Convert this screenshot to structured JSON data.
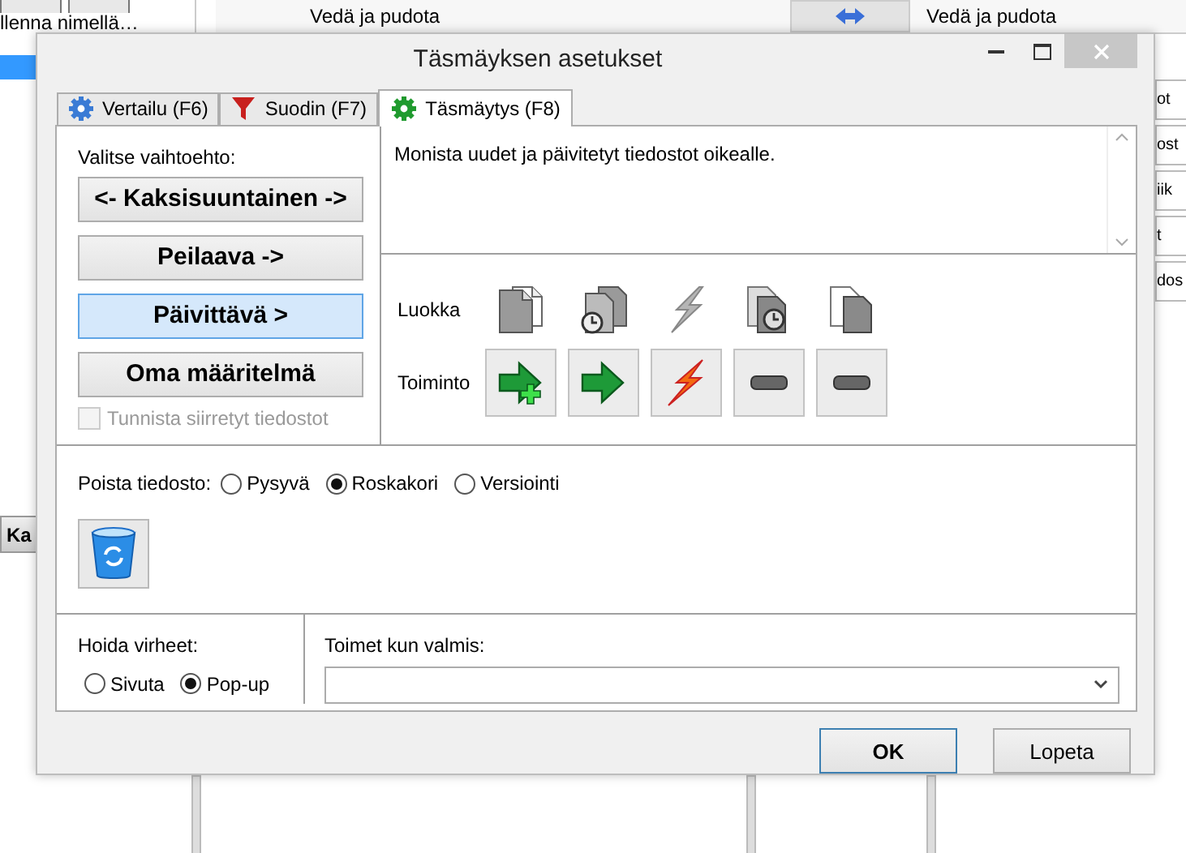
{
  "background": {
    "toolbar_label": "llenna nimellä…",
    "column_headers": [
      "Vedä ja pudota",
      "Vedä ja pudota"
    ],
    "side_button": "Ka",
    "right_items": [
      "ot",
      "ost",
      "iik",
      "t",
      "dos"
    ]
  },
  "window": {
    "title": "Täsmäyksen asetukset"
  },
  "tabs": [
    {
      "label": "Vertailu (F6)",
      "kind": "gear",
      "selected": false
    },
    {
      "label": "Suodin (F7)",
      "kind": "funnel",
      "selected": false
    },
    {
      "label": "Täsmäytys (F8)",
      "kind": "sync",
      "selected": true
    }
  ],
  "variants": {
    "label": "Valitse vaihtoehto:",
    "options": [
      {
        "label": "<- Kaksisuuntainen ->",
        "selected": false
      },
      {
        "label": "Peilaava ->",
        "selected": false
      },
      {
        "label": "Päivittävä >",
        "selected": true
      },
      {
        "label": "Oma määritelmä",
        "selected": false
      }
    ],
    "detect_moved": {
      "label": "Tunnista siirretyt tiedostot",
      "checked": false,
      "disabled": true
    }
  },
  "description": "Monista uudet ja päivitetyt tiedostot oikealle.",
  "category": {
    "label": "Luokka",
    "items": [
      {
        "kind": "leftonly"
      },
      {
        "kind": "leftnewer"
      },
      {
        "kind": "conflict"
      },
      {
        "kind": "rightnewer"
      },
      {
        "kind": "rightonly"
      }
    ]
  },
  "action": {
    "label": "Toiminto",
    "items": [
      {
        "kind": "create"
      },
      {
        "kind": "overwrite"
      },
      {
        "kind": "conflict"
      },
      {
        "kind": "none"
      },
      {
        "kind": "none"
      }
    ]
  },
  "deletion": {
    "label": "Poista tiedosto:",
    "options": [
      {
        "label": "Pysyvä",
        "selected": false
      },
      {
        "label": "Roskakori",
        "selected": true
      },
      {
        "label": "Versiointi",
        "selected": false
      }
    ]
  },
  "errors": {
    "label": "Hoida virheet:",
    "options": [
      {
        "label": "Sivuta",
        "selected": false
      },
      {
        "label": "Pop-up",
        "selected": true
      }
    ]
  },
  "on_completion": {
    "label": "Toimet kun valmis:"
  },
  "buttons": [
    {
      "label": "OK",
      "default": true
    },
    {
      "label": "Lopeta",
      "default": false
    }
  ]
}
